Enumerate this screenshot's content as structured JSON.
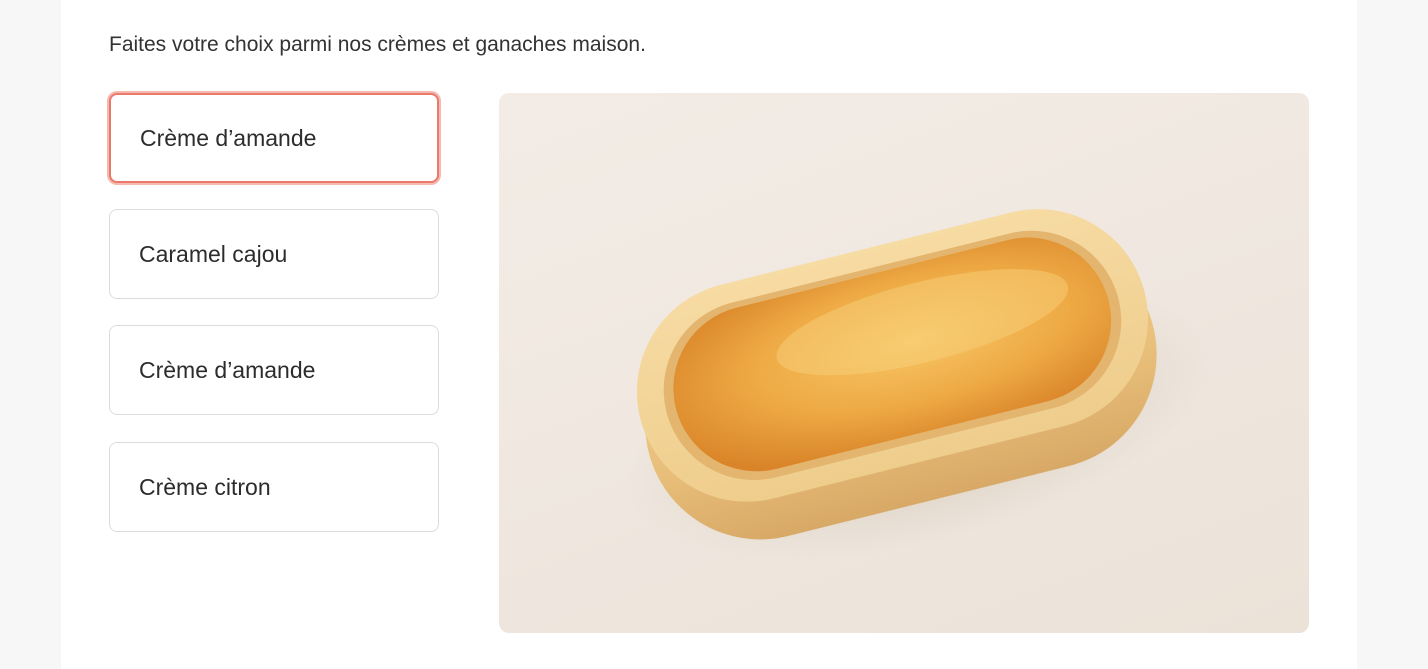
{
  "intro_text": "Faites votre choix parmi nos crèmes et ganaches maison.",
  "options": [
    {
      "label": "Crème d’amande",
      "selected": true
    },
    {
      "label": "Caramel cajou",
      "selected": false
    },
    {
      "label": "Crème d’amande",
      "selected": false
    },
    {
      "label": "Crème citron",
      "selected": false
    }
  ],
  "colors": {
    "selected_border": "#ec7a6a",
    "option_border": "#dcdcdc",
    "text": "#2c2c2c",
    "photo_background": "#f0e8e0"
  },
  "photo": {
    "subject": "oval-tartlet-image"
  }
}
